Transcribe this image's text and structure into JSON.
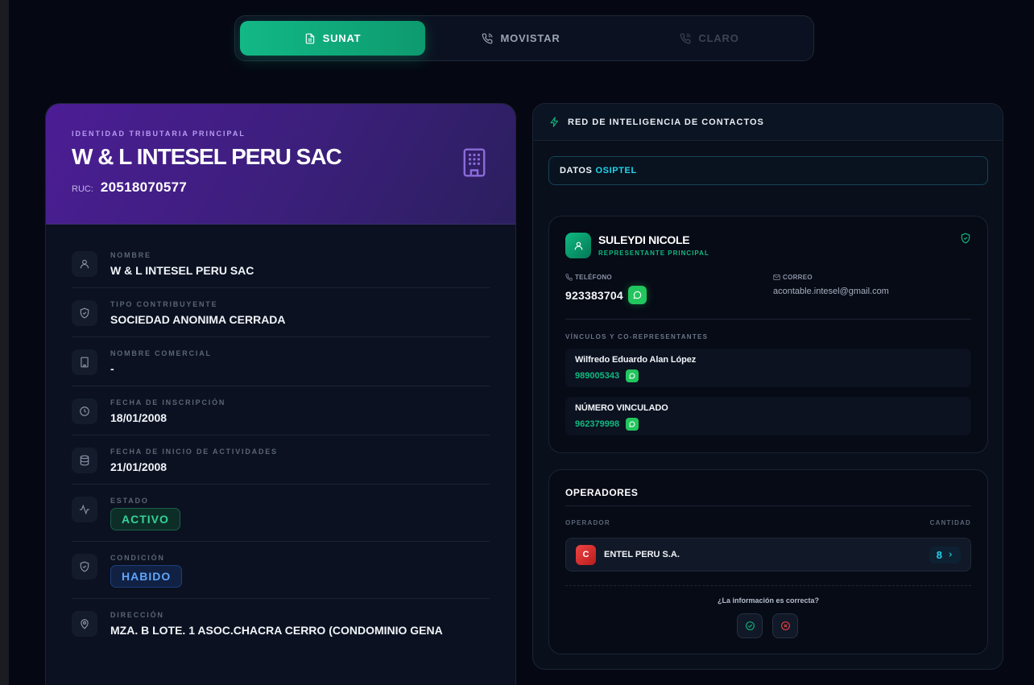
{
  "tabs": [
    {
      "label": "SUNAT",
      "icon": "document-icon",
      "state": "active"
    },
    {
      "label": "MOVISTAR",
      "icon": "phone-icon",
      "state": "normal"
    },
    {
      "label": "CLARO",
      "icon": "phone-icon",
      "state": "disabled"
    }
  ],
  "company": {
    "eyebrow": "IDENTIDAD TRIBUTARIA PRINCIPAL",
    "name": "W & L INTESEL PERU SAC",
    "ruc_label": "RUC:",
    "ruc": "20518070577",
    "icon": "building-icon"
  },
  "fields": [
    {
      "label": "NOMBRE",
      "value": "W & L INTESEL PERU SAC",
      "icon": "user-icon"
    },
    {
      "label": "TIPO CONTRIBUYENTE",
      "value": "SOCIEDAD ANONIMA CERRADA",
      "icon": "shield-icon"
    },
    {
      "label": "NOMBRE COMERCIAL",
      "value": "-",
      "icon": "building-icon"
    },
    {
      "label": "FECHA DE INSCRIPCIÓN",
      "value": "18/01/2008",
      "icon": "clock-icon"
    },
    {
      "label": "FECHA DE INICIO DE ACTIVIDADES",
      "value": "21/01/2008",
      "icon": "database-icon"
    },
    {
      "label": "ESTADO",
      "value": "ACTIVO",
      "icon": "activity-icon",
      "badge": "green"
    },
    {
      "label": "CONDICIÓN",
      "value": "HABIDO",
      "icon": "shield-icon",
      "badge": "blue"
    },
    {
      "label": "DIRECCIÓN",
      "value": "MZA. B LOTE. 1 ASOC.CHACRA CERRO (CONDOMINIO GENA",
      "icon": "map-pin-icon"
    }
  ],
  "right": {
    "header": "RED DE INTELIGENCIA DE CONTACTOS",
    "osiptel_prefix": "DATOS",
    "osiptel_accent": "OSIPTEL",
    "contact": {
      "name": "SULEYDI NICOLE",
      "role": "REPRESENTANTE PRINCIPAL",
      "phone_label": "TELÉFONO",
      "phone": "923383704",
      "email_label": "CORREO",
      "email": "acontable.intesel@gmail.com"
    },
    "vinculos_label": "VÍNCULOS Y CO-REPRESENTANTES",
    "vinculos": [
      {
        "name": "Wilfredo Eduardo Alan López",
        "phone": "989005343"
      },
      {
        "name": "NÚMERO VINCULADO",
        "phone": "962379998"
      }
    ],
    "operators": {
      "title": "OPERADORES",
      "col_operator": "OPERADOR",
      "col_count": "CANTIDAD",
      "rows": [
        {
          "logo": "C",
          "name": "ENTEL PERU S.A.",
          "count": "8"
        }
      ],
      "question": "¿La información es correcta?"
    }
  },
  "colors": {
    "accent_green": "#10b981",
    "accent_cyan": "#22d3ee",
    "purple_header": "#4c1d95",
    "background": "#050813"
  }
}
